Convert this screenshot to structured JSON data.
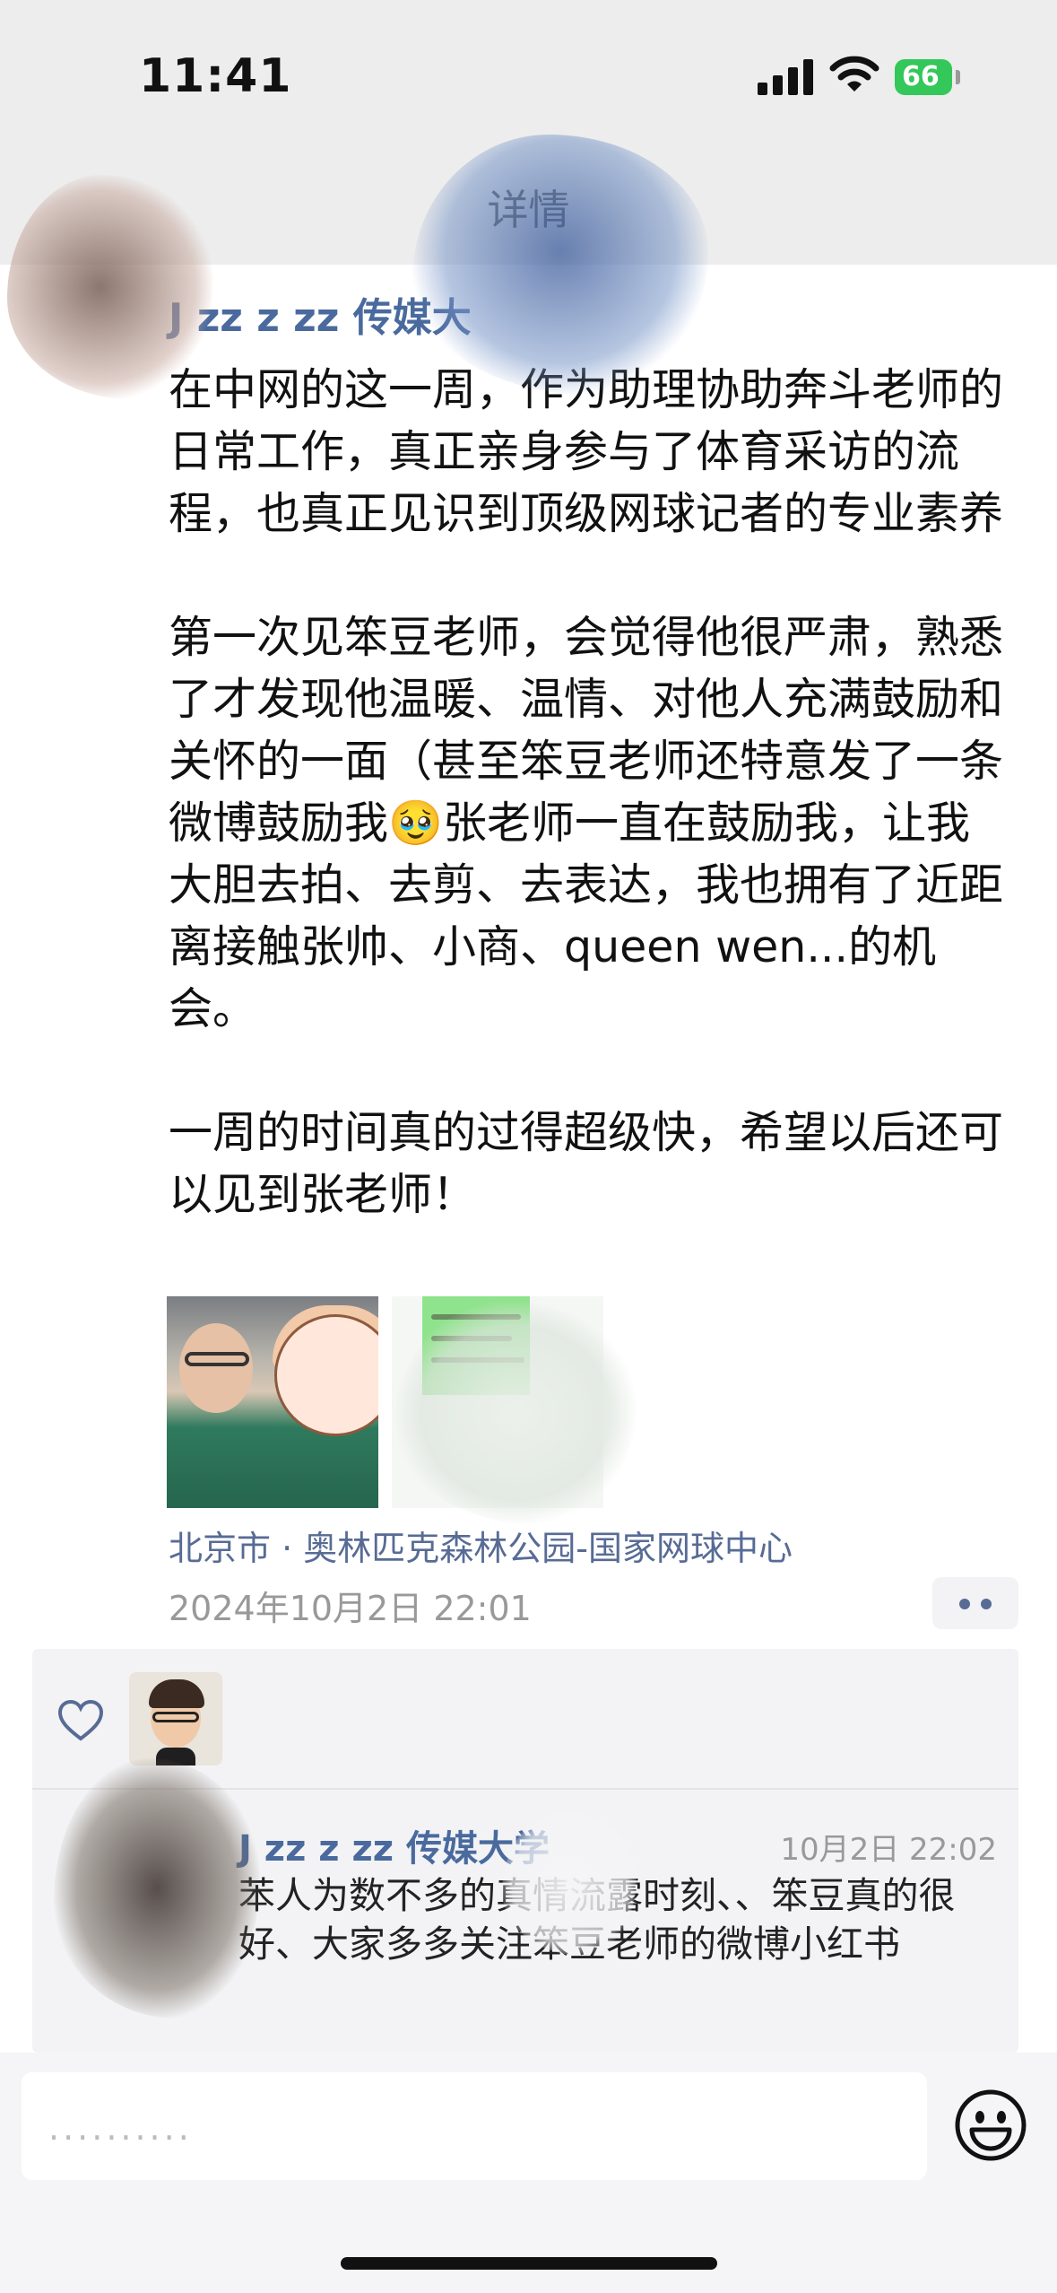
{
  "status_bar": {
    "time": "11:41",
    "battery_level": "66",
    "icons": [
      "signal-icon",
      "wifi-icon",
      "battery-icon"
    ]
  },
  "nav": {
    "title": "详情"
  },
  "post": {
    "author_name": "J zz z zz 传媒大",
    "text": "在中网的这一周，作为助理协助奔斗老师的日常工作，真正亲身参与了体育采访的流程，也真正见识到顶级网球记者的专业素养\n\n第一次见笨豆老师，会觉得他很严肃，熟悉了才发现他温暖、温情、对他人充满鼓励和关怀的一面（甚至笨豆老师还特意发了一条微博鼓励我🥹张老师一直在鼓励我，让我大胆去拍、去剪、去表达，我也拥有了近距离接触张帅、小商、queen wen...的机会。\n\n一周的时间真的过得超级快，希望以后还可以见到张老师！",
    "photos": [
      "photo-portrait",
      "photo-chat-screenshot"
    ],
    "location": "北京市 · 奥林匹克森林公园-国家网球中心",
    "timestamp": "2024年10月2日 22:01"
  },
  "interactions": {
    "like_icon": "heart-outline-icon",
    "comment": {
      "author": "J zz z zz 传媒大学",
      "time": "10月2日 22:02",
      "text": "苯人为数不多的真情流露时刻、、笨豆真的很好、大家多多关注笨豆老师的微博小红书"
    }
  },
  "composer": {
    "placeholder": "..........",
    "emoji_icon": "smiley-icon"
  },
  "colors": {
    "link": "#576b95",
    "author": "#4a6a9e",
    "battery": "#34c759",
    "background_gray": "#ededed"
  }
}
